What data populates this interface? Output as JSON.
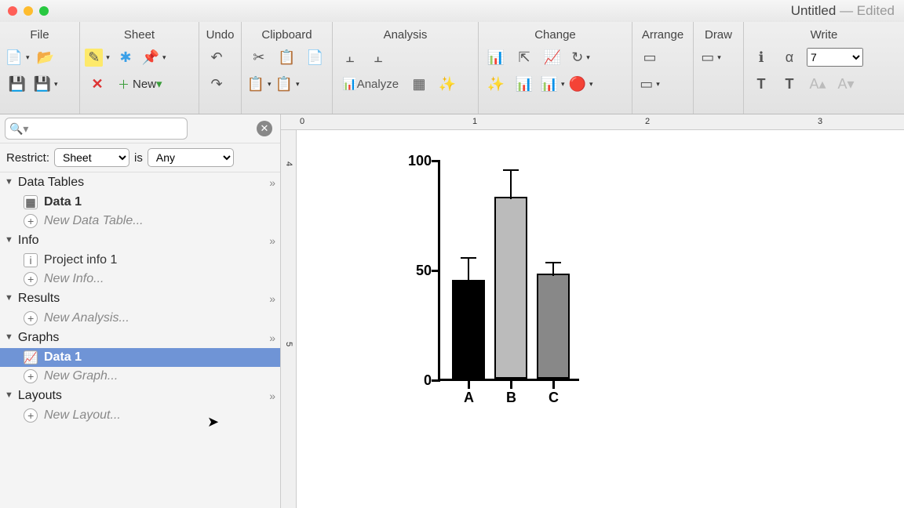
{
  "window": {
    "title": "Untitled",
    "status": "Edited"
  },
  "toolbar": {
    "groups": {
      "file": "File",
      "sheet": "Sheet",
      "undo": "Undo",
      "clipboard": "Clipboard",
      "analysis": "Analysis",
      "change": "Change",
      "arrange": "Arrange",
      "draw": "Draw",
      "write": "Write"
    },
    "new_label": "New",
    "analyze_label": "Analyze",
    "font_size": "7"
  },
  "sidebar": {
    "search_placeholder": "",
    "restrict_label": "Restrict:",
    "restrict_field": "Sheet",
    "restrict_is": "is",
    "restrict_value": "Any",
    "sections": [
      {
        "name": "Data Tables",
        "items": [
          {
            "label": "Data 1",
            "kind": "table",
            "bold": true
          },
          {
            "label": "New Data Table...",
            "kind": "add"
          }
        ]
      },
      {
        "name": "Info",
        "items": [
          {
            "label": "Project info 1",
            "kind": "info"
          },
          {
            "label": "New Info...",
            "kind": "add"
          }
        ]
      },
      {
        "name": "Results",
        "items": [
          {
            "label": "New Analysis...",
            "kind": "add"
          }
        ]
      },
      {
        "name": "Graphs",
        "items": [
          {
            "label": "Data 1",
            "kind": "graph",
            "selected": true,
            "bold": true
          },
          {
            "label": "New Graph...",
            "kind": "add"
          }
        ]
      },
      {
        "name": "Layouts",
        "items": [
          {
            "label": "New Layout...",
            "kind": "add"
          }
        ]
      }
    ]
  },
  "ruler": {
    "h": [
      "0",
      "1",
      "2",
      "3"
    ],
    "v": [
      "4",
      "5"
    ]
  },
  "chart_data": {
    "type": "bar",
    "categories": [
      "A",
      "B",
      "C"
    ],
    "values": [
      45,
      83,
      48
    ],
    "errors": [
      11,
      13,
      6
    ],
    "ylim": [
      0,
      100
    ],
    "yticks": [
      0,
      50,
      100
    ],
    "title": "",
    "xlabel": "",
    "ylabel": ""
  }
}
